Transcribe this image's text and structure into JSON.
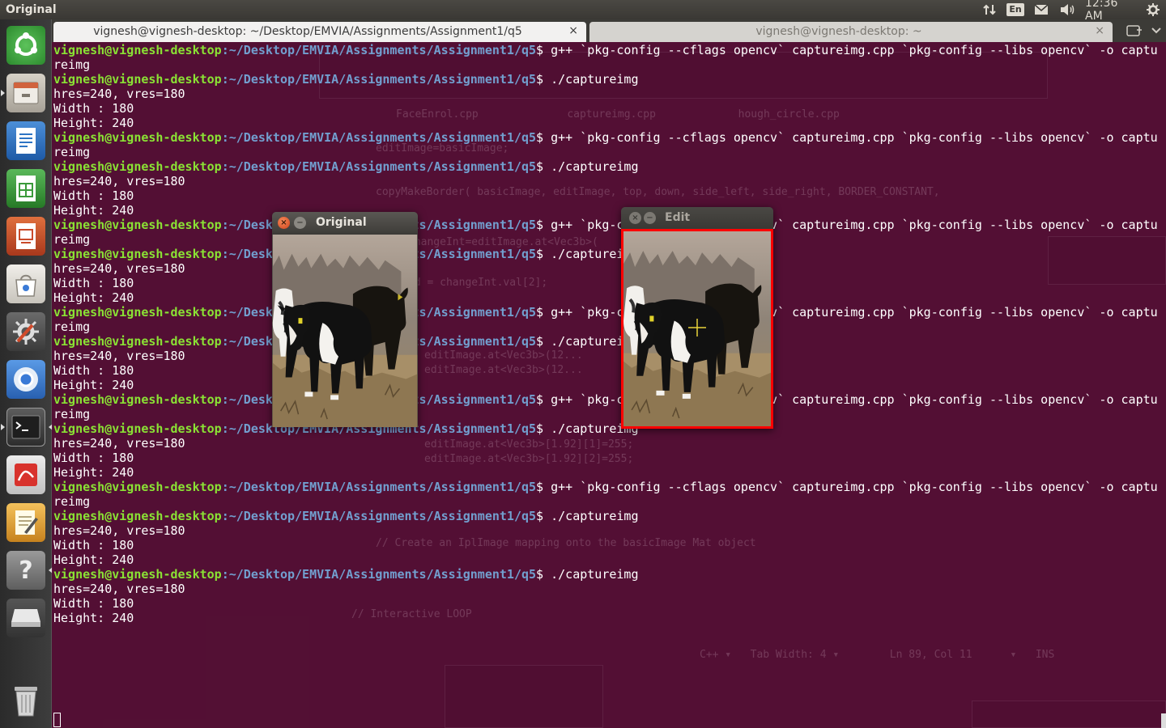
{
  "top_panel": {
    "app_title": "Original",
    "keyboard_layout": "En",
    "clock": "12:36 AM"
  },
  "launcher": {
    "items": [
      {
        "icon": "ubuntu-dash-icon",
        "color": "#41b145"
      },
      {
        "icon": "file-manager-icon",
        "color": "#c9483a"
      },
      {
        "icon": "writer-icon",
        "color": "#2d74c4"
      },
      {
        "icon": "calc-icon",
        "color": "#3a9a3a"
      },
      {
        "icon": "impress-icon",
        "color": "#c94a2a"
      },
      {
        "icon": "software-center-icon",
        "color": "#e0e0e0"
      },
      {
        "icon": "system-settings-icon",
        "color": "#555555"
      },
      {
        "icon": "chromium-icon",
        "color": "#3a7ad6"
      },
      {
        "icon": "terminal-icon",
        "color": "#2b2b2b"
      },
      {
        "icon": "pdf-reader-icon",
        "color": "#c83030"
      },
      {
        "icon": "text-editor-icon",
        "color": "#e8a030"
      },
      {
        "icon": "help-icon",
        "color": "#777777"
      },
      {
        "icon": "removable-drive-icon",
        "color": "#dddddd"
      },
      {
        "icon": "trash-icon",
        "color": "#888888"
      }
    ]
  },
  "tabs": [
    {
      "label": "vignesh@vignesh-desktop: ~/Desktop/EMVIA/Assignments/Assignment1/q5",
      "close": "×"
    },
    {
      "label": "vignesh@vignesh-desktop: ~",
      "close": "×"
    }
  ],
  "terminal": {
    "prompt_user": "vignesh@vignesh-desktop",
    "prompt_path": ":~/Desktop/EMVIA/Assignments/Assignment1/q5",
    "prompt_sign": "$ ",
    "compile_cmd": "g++ `pkg-config --cflags opencv` captureimg.cpp `pkg-config --libs opencv` -o captu",
    "compile_wrap": "reimg",
    "run_cmd": "./captureimg",
    "out_res": "hres=240, vres=180",
    "out_width": "Width : 180",
    "out_height": "Height: 240",
    "blocks": 7
  },
  "windows": {
    "original": {
      "title": "Original",
      "close": "×",
      "min": "−"
    },
    "edit": {
      "title": "Edit",
      "close": "×",
      "min": "−"
    }
  }
}
